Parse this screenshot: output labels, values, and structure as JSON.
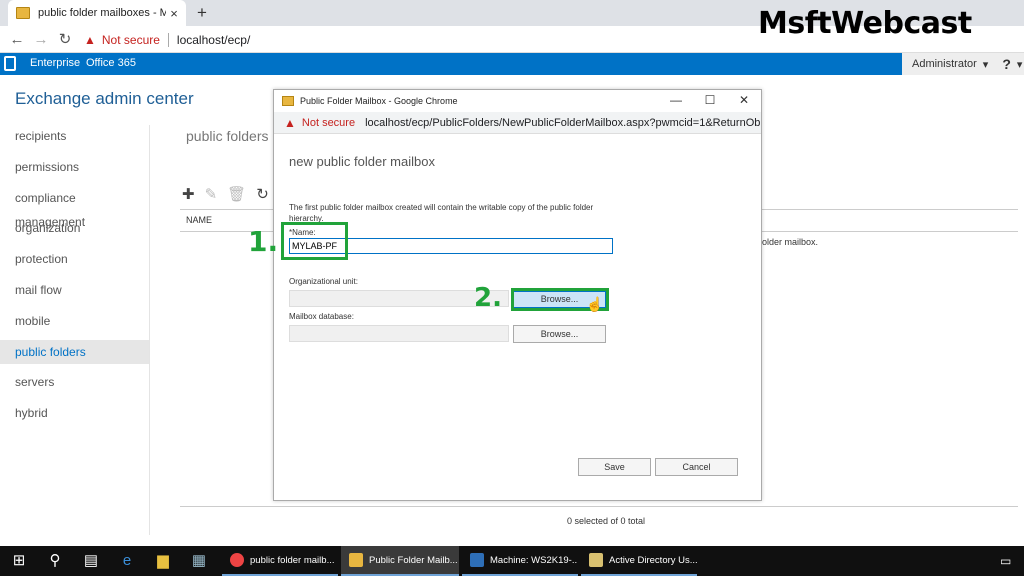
{
  "browser": {
    "tab_title": "public folder mailboxes - Microso",
    "tab_close": "×",
    "new_tab": "+",
    "not_secure": "Not secure",
    "url": "localhost/ecp/"
  },
  "brand": "MsftWebcast",
  "eac_bar": {
    "enterprise": "Enterprise",
    "office365": "Office 365",
    "admin": "Administrator",
    "admin_caret": "▾",
    "help": "?",
    "help_caret": "▾"
  },
  "eac": {
    "title": "Exchange admin center",
    "nav": [
      {
        "label": "recipients"
      },
      {
        "label": "permissions"
      },
      {
        "label": "compliance management"
      },
      {
        "label": "organization"
      },
      {
        "label": "protection"
      },
      {
        "label": "mail flow"
      },
      {
        "label": "mobile"
      },
      {
        "label": "public folders",
        "selected": true
      },
      {
        "label": "servers"
      },
      {
        "label": "hybrid"
      }
    ],
    "section_title": "public folders",
    "grid_header": "NAME",
    "grid_message": "older mailbox.",
    "selected_count": "0 selected of 0 total"
  },
  "popup": {
    "window_title": "Public Folder Mailbox - Google Chrome",
    "not_secure": "Not secure",
    "url": "localhost/ecp/PublicFolders/NewPublicFolderMailbox.aspx?pwmcid=1&ReturnOb...",
    "header": "new public folder mailbox",
    "description": "The first public folder mailbox created will contain the writable copy of the public folder hierarchy.",
    "name_label": "*Name:",
    "name_value": "MYLAB-PF",
    "ou_label": "Organizational unit:",
    "browse_label": "Browse...",
    "db_label": "Mailbox database:",
    "browse2_label": "Browse...",
    "save_label": "Save",
    "cancel_label": "Cancel"
  },
  "annotations": {
    "step1": "1.",
    "step2": "2."
  },
  "taskbar": {
    "apps": [
      {
        "label": "public folder mailb...",
        "icon": "chrome-icon"
      },
      {
        "label": "Public Folder Mailb...",
        "icon": "exchange-popup-icon"
      },
      {
        "label": "Machine: WS2K19-...",
        "icon": "exchange-shell-icon"
      },
      {
        "label": "Active Directory Us...",
        "icon": "ad-users-icon"
      }
    ]
  },
  "colors": {
    "accent": "#0072c6",
    "annotation_green": "#21a33a",
    "warning_red": "#c5221f"
  }
}
